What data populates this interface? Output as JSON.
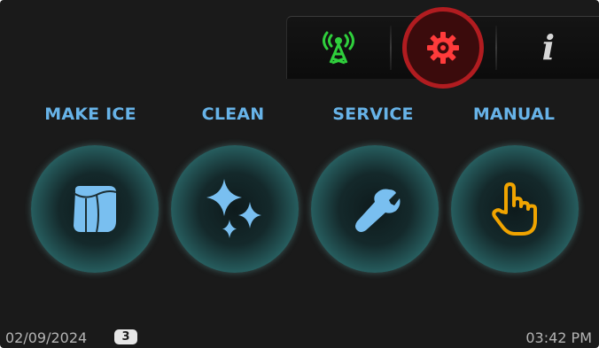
{
  "toolbar": {
    "buttons": [
      {
        "name": "network",
        "icon": "radio-tower-icon",
        "color": "#2fcf3c"
      },
      {
        "name": "settings",
        "icon": "gear-icon",
        "color": "#ff3b3b",
        "highlight": "#b11c20"
      },
      {
        "name": "info",
        "icon": "info-icon",
        "glyph": "i",
        "color": "#d6d6d6"
      }
    ]
  },
  "actions": [
    {
      "label": "MAKE ICE",
      "icon": "ice-cube-icon",
      "color": "#79bff0"
    },
    {
      "label": "CLEAN",
      "icon": "sparkle-icon",
      "color": "#79bff0"
    },
    {
      "label": "SERVICE",
      "icon": "wrench-icon",
      "color": "#79bff0"
    },
    {
      "label": "MANUAL",
      "icon": "hand-pointer-icon",
      "color": "#f0a400"
    }
  ],
  "footer": {
    "date": "02/09/2024",
    "badge": "3",
    "time": "03:42 PM"
  },
  "colors": {
    "label": "#67b3e8",
    "background": "#1a1a1a",
    "ring": "#67c8c6"
  }
}
